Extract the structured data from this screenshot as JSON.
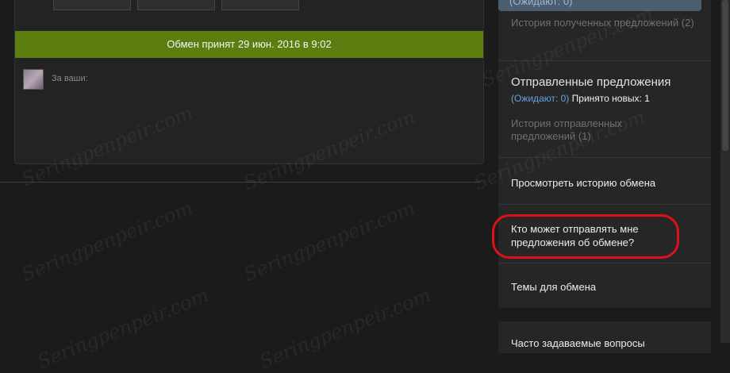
{
  "trade": {
    "status_bar": "Обмен принят 29 июн. 2016 в 9:02",
    "for_yours_label": "За ваши:"
  },
  "panel": {
    "top_tab_label": "(Ожидают: 0)",
    "received_history": "История полученных предложений (2)",
    "sent": {
      "title": "Отправленные предложения",
      "pending": "(Ожидают: 0)",
      "accepted_new": "Принято новых: 1",
      "history": "История отправленных предложений (1)"
    },
    "links": {
      "trade_history": "Просмотреть историю обмена",
      "who_can_send": "Кто может отправлять мне предложения об обмене?",
      "trade_topics": "Темы для обмена"
    },
    "faq": "Часто задаваемые вопросы"
  },
  "watermark": "Seringpenpeir.com",
  "colors": {
    "accepted_bar": "#5c7e10",
    "link_blue": "#67a3d6",
    "annotation_red": "#e0101a"
  }
}
